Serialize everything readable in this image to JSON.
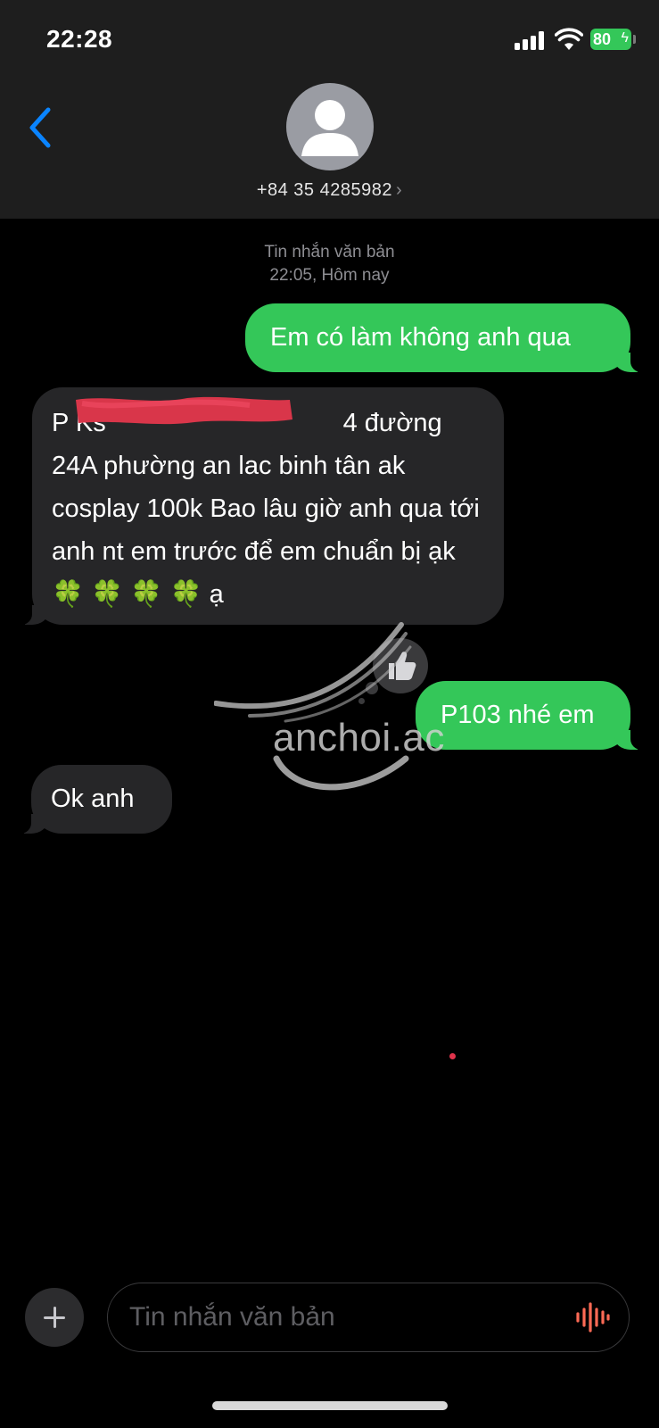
{
  "status_bar": {
    "time": "22:28",
    "battery": "80",
    "battery_color": "#34c759"
  },
  "header": {
    "contact_name": "+84 35 4285982",
    "chevron": "›",
    "back_icon": "chevron-left-icon",
    "avatar_icon": "person-avatar-icon",
    "accent_color": "#0a84ff"
  },
  "thread": {
    "meta": {
      "label": "Tin nhắn văn bản",
      "time": "22:05, Hôm nay"
    },
    "messages": [
      {
        "direction": "outgoing",
        "text": "Em có làm không anh qua"
      },
      {
        "direction": "incoming",
        "text": "P Ks                                 4 đường 24A phường an lac binh tân ak cosplay 100k Bao lâu  giờ anh qua tới anh nt em trước để em chuẩn bị ạk 🍀 🍀 🍀 🍀 ạ",
        "redacted": true
      },
      {
        "direction": "outgoing",
        "text": "P103 nhé em",
        "tapback": "thumbs-up-icon"
      },
      {
        "direction": "incoming",
        "text": "Ok anh"
      }
    ],
    "outgoing_color": "#34c759",
    "incoming_color": "#262628"
  },
  "watermark": {
    "text": "anchoi.ac"
  },
  "compose": {
    "placeholder": "Tin nhắn văn bản",
    "plus_icon": "plus-icon",
    "voice_icon": "waveform-icon"
  }
}
